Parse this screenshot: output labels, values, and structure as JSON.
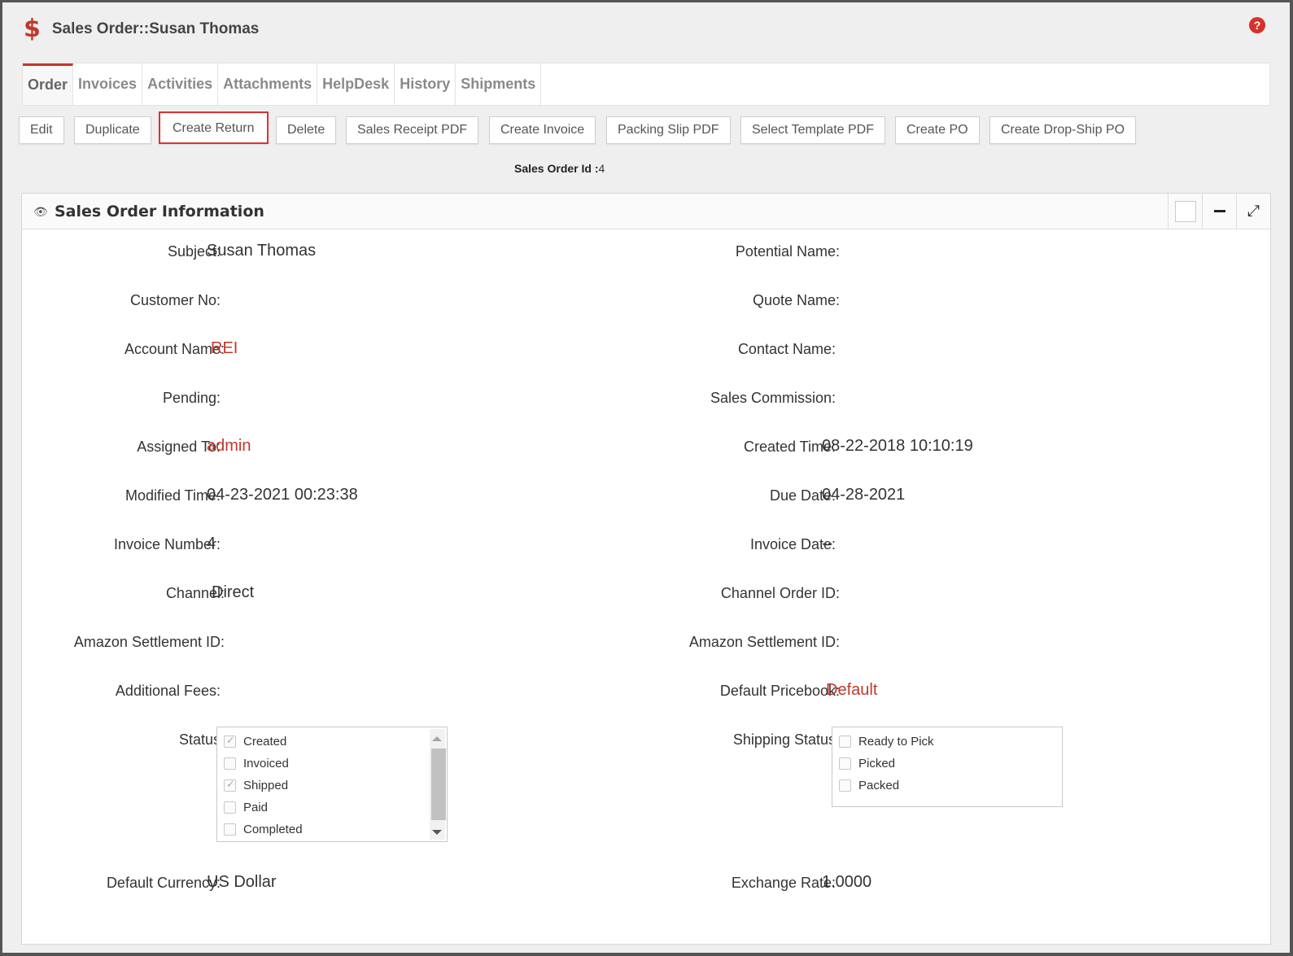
{
  "header": {
    "icon": "dollar-icon",
    "title": "Sales Order::Susan Thomas"
  },
  "tabs": [
    "Order",
    "Invoices",
    "Activities",
    "Attachments",
    "HelpDesk",
    "History",
    "Shipments"
  ],
  "toolbar": {
    "edit": "Edit",
    "duplicate": "Duplicate",
    "create_return": "Create Return",
    "delete": "Delete",
    "sales_receipt_pdf": "Sales Receipt PDF",
    "create_invoice": "Create Invoice",
    "packing_slip_pdf": "Packing Slip PDF",
    "select_template_pdf": "Select Template PDF",
    "create_po": "Create PO",
    "create_drop_ship_po": "Create Drop-Ship PO"
  },
  "sales_order_id": {
    "label": "Sales Order Id :",
    "value": "4"
  },
  "panel": {
    "title": "Sales Order Information"
  },
  "fields": {
    "subject": {
      "label": "Subject:",
      "value": "Susan Thomas"
    },
    "potential_name": {
      "label": "Potential Name:",
      "value": ""
    },
    "customer_no": {
      "label": "Customer No:",
      "value": ""
    },
    "quote_name": {
      "label": "Quote Name:",
      "value": ""
    },
    "account_name": {
      "label": "Account Name:",
      "value": "REI"
    },
    "contact_name": {
      "label": "Contact Name:",
      "value": ""
    },
    "pending": {
      "label": "Pending:",
      "value": ""
    },
    "sales_commission": {
      "label": "Sales Commission:",
      "value": ""
    },
    "assigned_to": {
      "label": "Assigned To:",
      "value": "admin"
    },
    "created_time": {
      "label": "Created Time:",
      "value": "08-22-2018 10:10:19"
    },
    "modified_time": {
      "label": "Modified Time:",
      "value": "04-23-2021 00:23:38"
    },
    "due_date": {
      "label": "Due Date:",
      "value": "04-28-2021"
    },
    "invoice_number": {
      "label": "Invoice Number:",
      "value": "4"
    },
    "invoice_date": {
      "label": "Invoice Date:",
      "value": "--"
    },
    "channel": {
      "label": "Channel:",
      "value": "Direct"
    },
    "channel_order_id": {
      "label": "Channel Order ID:",
      "value": ""
    },
    "amazon_settlement_id_left": {
      "label": "Amazon Settlement ID:",
      "value": ""
    },
    "amazon_settlement_id_right": {
      "label": "Amazon Settlement ID:",
      "value": ""
    },
    "additional_fees": {
      "label": "Additional Fees:",
      "value": ""
    },
    "default_pricebook": {
      "label": "Default Pricebook:",
      "value": "Default"
    },
    "status": {
      "label": "Status:"
    },
    "shipping_status": {
      "label": "Shipping Status:"
    },
    "default_currency": {
      "label": "Default Currency:",
      "value": "US Dollar"
    },
    "exchange_rate": {
      "label": "Exchange Rate:",
      "value": "1.0000"
    }
  },
  "status_options": [
    {
      "label": "Created",
      "checked": true
    },
    {
      "label": "Invoiced",
      "checked": false
    },
    {
      "label": "Shipped",
      "checked": true
    },
    {
      "label": "Paid",
      "checked": false
    },
    {
      "label": "Completed",
      "checked": false
    }
  ],
  "shipping_status_options": [
    {
      "label": "Ready to Pick",
      "checked": false
    },
    {
      "label": "Picked",
      "checked": false
    },
    {
      "label": "Packed",
      "checked": false
    }
  ],
  "colors": {
    "accent": "#c0392b",
    "highlight_border": "#dd3333"
  }
}
